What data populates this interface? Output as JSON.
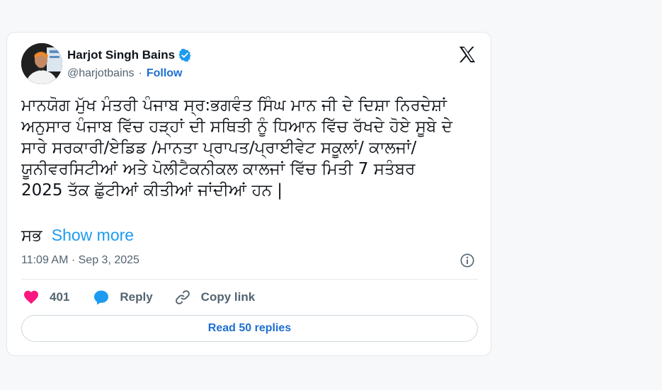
{
  "author": {
    "name": "Harjot Singh Bains",
    "handle": "@harjotbains",
    "separator": "·",
    "follow_label": "Follow",
    "verified_color": "#1d9bf0"
  },
  "tweet": {
    "lines": [
      "ਮਾਨਯੋਗ ਮੁੱਖ ਮੰਤਰੀ ਪੰਜਾਬ ਸ੍ਰ:ਭਗਵੰਤ ਸਿੰਘ ਮਾਨ ਜੀ ਦੇ ਦਿਸ਼ਾ ਨਿਰਦੇਸ਼ਾਂ",
      "ਅਨੁਸਾਰ ਪੰਜਾਬ ਵਿੱਚ ਹੜ੍ਹਾਂ ਦੀ ਸਥਿਤੀ ਨੂੰ ਧਿਆਨ ਵਿੱਚ ਰੱਖਦੇ ਹੋਏ ਸੂਬੇ ਦੇ",
      "ਸਾਰੇ ਸਰਕਾਰੀ/ਏਡਿਡ /ਮਾਨਤਾ ਪ੍ਰਾਪਤ/ਪ੍ਰਾਈਵੇਟ ਸਕੂਲਾਂ/ ਕਾਲਜਾਂ/",
      "ਯੂਨੀਵਰਸਿਟੀਆਂ ਅਤੇ ਪੋਲੀਟੈਕਨੀਕਲ ਕਾਲਜਾਂ ਵਿੱਚ ਮਿਤੀ 7 ਸਤੰਬਰ",
      "2025 ਤੱਕ ਛੁੱਟੀਆਂ ਕੀਤੀਆਂ ਜਾਂਦੀਆਂ ਹਨ |"
    ],
    "truncated_word": "ਸਭ",
    "show_more_label": "Show more",
    "timestamp": "11:09 AM · Sep 3, 2025"
  },
  "actions": {
    "likes_count": "401",
    "reply_label": "Reply",
    "copy_link_label": "Copy link"
  },
  "read_replies_label": "Read 50 replies",
  "colors": {
    "accent": "#1d9bf0",
    "like": "#f91880",
    "link": "#1d6fd2"
  },
  "icons": [
    "verified-badge-icon",
    "x-logo-icon",
    "info-icon",
    "heart-icon",
    "reply-bubble-icon",
    "link-icon"
  ]
}
